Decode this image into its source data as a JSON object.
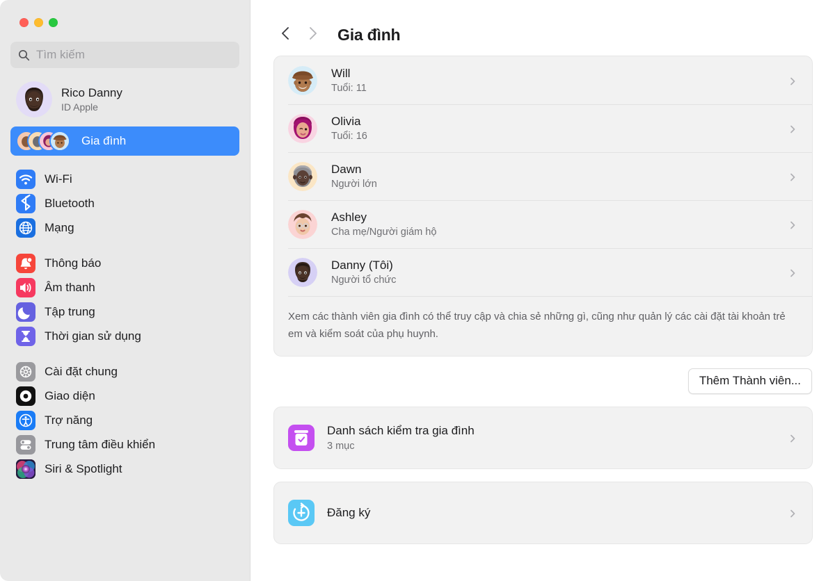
{
  "window": {
    "traffic_lights": [
      {
        "name": "close",
        "color": "#ff5f57"
      },
      {
        "name": "minimize",
        "color": "#febc2e"
      },
      {
        "name": "zoom",
        "color": "#28c840"
      }
    ]
  },
  "sidebar": {
    "search": {
      "placeholder": "Tìm kiếm",
      "value": "",
      "icon": "search-icon"
    },
    "account": {
      "name": "Rico Danny",
      "subtitle": "ID Apple",
      "avatar": "memoji-danny"
    },
    "selected_item": {
      "label": "Gia đình",
      "icon": "family-avatars-cluster",
      "selected": true,
      "accent": "#3c8cfb"
    },
    "groups": [
      {
        "items": [
          {
            "label": "Wi-Fi",
            "icon": "wifi-icon",
            "color": "#2f7cf6"
          },
          {
            "label": "Bluetooth",
            "icon": "bluetooth-icon",
            "color": "#2f7cf6"
          },
          {
            "label": "Mạng",
            "icon": "network-globe-icon",
            "color": "#1a6fe0"
          }
        ]
      },
      {
        "items": [
          {
            "label": "Thông báo",
            "icon": "notifications-bell-icon",
            "color": "#f6453a"
          },
          {
            "label": "Âm thanh",
            "icon": "sound-speaker-icon",
            "color": "#f6395f"
          },
          {
            "label": "Tập trung",
            "icon": "focus-moon-icon",
            "color": "#6561e0"
          },
          {
            "label": "Thời gian sử dụng",
            "icon": "screen-time-hourglass-icon",
            "color": "#6f63e8"
          }
        ]
      },
      {
        "items": [
          {
            "label": "Cài đặt chung",
            "icon": "general-gear-icon",
            "color": "#9a9a9e"
          },
          {
            "label": "Giao diện",
            "icon": "appearance-contrast-icon",
            "color": "#1d1d1f"
          },
          {
            "label": "Trợ năng",
            "icon": "accessibility-icon",
            "color": "#1a7cf6"
          },
          {
            "label": "Trung tâm điều khiển",
            "icon": "control-center-toggles-icon",
            "color": "#98989d"
          },
          {
            "label": "Siri & Spotlight",
            "icon": "siri-orb-icon",
            "color": "#5b3f8e"
          }
        ]
      }
    ]
  },
  "main": {
    "nav": {
      "back_icon": "chevron-left-icon",
      "forward_icon": "chevron-right-icon"
    },
    "title": "Gia đình",
    "members": [
      {
        "name": "Will",
        "role": "Tuổi: 11",
        "avatar": "memoji-will",
        "avatar_bg": "#d6ecf7"
      },
      {
        "name": "Olivia",
        "role": "Tuổi: 16",
        "avatar": "memoji-olivia",
        "avatar_bg": "#f9d4e2"
      },
      {
        "name": "Dawn",
        "role": "Người lớn",
        "avatar": "memoji-dawn",
        "avatar_bg": "#fbe6c5"
      },
      {
        "name": "Ashley",
        "role": "Cha mẹ/Người giám hộ",
        "avatar": "memoji-ashley",
        "avatar_bg": "#fbd4d4"
      },
      {
        "name": "Danny (Tôi)",
        "role": "Người tổ chức",
        "avatar": "memoji-danny",
        "avatar_bg": "#d6d0f5"
      }
    ],
    "description": "Xem các thành viên gia đình có thể truy cập và chia sẻ những gì, cũng như quản lý các cài đặt tài khoản trẻ em và kiểm soát của phụ huynh.",
    "add_member_button": "Thêm Thành viên...",
    "links": [
      {
        "title": "Danh sách kiểm tra gia đình",
        "subtitle": "3 mục",
        "icon": "family-checklist-icon",
        "color": "#c44ff0"
      },
      {
        "title": "Đăng ký",
        "subtitle": "",
        "icon": "subscriptions-icon",
        "color": "#5ac8f5"
      }
    ]
  }
}
